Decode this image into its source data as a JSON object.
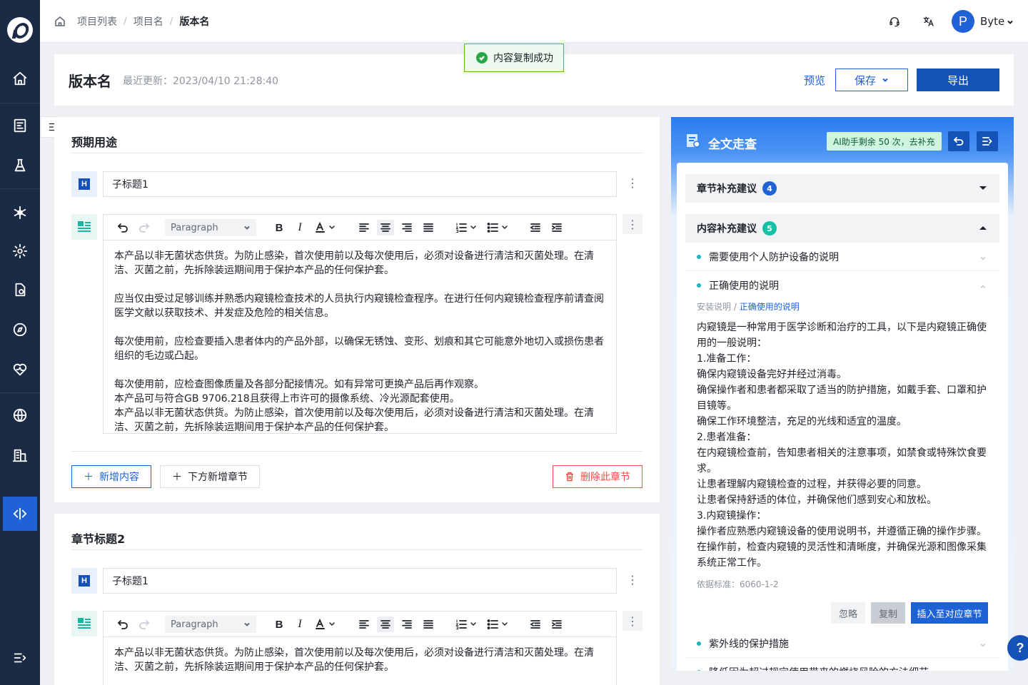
{
  "breadcrumb": [
    "项目列表",
    "项目名",
    "版本名"
  ],
  "user": {
    "avatar_letter": "P",
    "name": "Byte"
  },
  "header": {
    "title": "版本名",
    "updated": "最近更新：2023/04/10 21:28:40",
    "preview_label": "预览",
    "save_label": "保存",
    "export_label": "导出"
  },
  "toast": {
    "text": "内容复制成功"
  },
  "sidebar": {
    "icons": [
      "home-icon",
      "report-icon",
      "flask-icon",
      "snowflake-icon",
      "gear-icon",
      "file-icon",
      "compass-icon",
      "heart-icon",
      "globe-icon",
      "building-icon",
      "code-icon",
      "expand-icon"
    ]
  },
  "chapters": [
    {
      "title": "预期用途",
      "subtitle": "子标题1",
      "editor": {
        "paragraph_select": "Paragraph",
        "blocks": [
          [
            "本产品以非无菌状态供货。为防止感染，首次使用前以及每次使用后，必须对设备进行清洁和灭菌处理。在清",
            "洁、灭菌之前，先拆除装运期间用于保护本产品的任何保护套。"
          ],
          [
            "应当仅由受过足够训练并熟悉内窥镜检查技术的人员执行内窥镜检查程序。在进行任何内窥镜检查程序前请查阅",
            "医学文献以获取技术、并发症及危险的相关信息。"
          ],
          [
            "每次使用前，应检查要插入患者体内的产品外部，以确保无锈蚀、变形、划痕和其它可能意外地切入或损伤患者",
            "组织的毛边或凸起。"
          ],
          [
            "每次使用前，应检查图像质量及各部分配接情况。如有异常可更换产品后再作观察。",
            "本产品可与符合GB 9706.218且获得上市许可的摄像系统、冷光源配套使用。",
            "本产品以非无菌状态供货。为防止感染，首次使用前以及每次使用后，必须对设备进行清洁和灭菌处理。在清",
            "洁、灭菌之前，先拆除装运期间用于保护本产品的任何保护套。"
          ]
        ]
      },
      "add_content_label": "新增内容",
      "add_chapter_label": "下方新增章节",
      "delete_chapter_label": "删除此章节"
    },
    {
      "title": "章节标题2",
      "subtitle": "子标题1",
      "editor": {
        "paragraph_select": "Paragraph",
        "blocks": [
          [
            "本产品以非无菌状态供货。为防止感染，首次使用前以及每次使用后，必须对设备进行清洁和灭菌处理。在清",
            "洁、灭菌之前，先拆除装运期间用于保护本产品的任何保护套。"
          ]
        ]
      }
    }
  ],
  "ai_panel": {
    "title": "全文走查",
    "quota": "AI助手剩余 50 次，去补充",
    "sections": [
      {
        "label": "章节补充建议",
        "count": "4",
        "count_color": "#1f62d5",
        "expanded": false
      },
      {
        "label": "内容补充建议",
        "count": "5",
        "count_color": "#14c0a6",
        "expanded": true
      }
    ],
    "items": [
      {
        "label": "需要使用个人防护设备的说明",
        "expanded": false
      },
      {
        "label": "正确使用的说明",
        "expanded": true
      },
      {
        "label": "紫外线的保护措施",
        "expanded": false
      },
      {
        "label": "降低因为超过规定使用带来的燃烧风险的方法细节",
        "expanded": false
      }
    ],
    "detail": {
      "path_prefix": "安装说明",
      "path_link": "正确使用的说明",
      "lines": [
        "内窥镜是一种常用于医学诊断和治疗的工具，以下是内窥镜正确使",
        "用的一般说明：",
        "1.准备工作：",
        "确保内窥镜设备完好并经过消毒。",
        "确保操作者和患者都采取了适当的防护措施，如戴手套、口罩和护",
        "目镜等。",
        "确保工作环境整洁，充足的光线和适宜的温度。",
        "2.患者准备：",
        "在内窥镜检查前，告知患者相关的注意事项，如禁食或特殊饮食要",
        "求。",
        "让患者理解内窥镜检查的过程，并获得必要的同意。",
        "让患者保持舒适的体位，并确保他们感到安心和放松。",
        "3.内窥镜操作：",
        "操作者应熟悉内窥镜设备的使用说明书，并遵循正确的操作步骤。",
        "在操作前，检查内窥镜的灵活性和清晰度，并确保光源和图像采集",
        "系统正常工作。"
      ],
      "standard": "依据标准：6060-1-2",
      "ignore_label": "忽略",
      "copy_label": "复制",
      "insert_label": "插入至对应章节"
    }
  },
  "help": {
    "label": "?"
  }
}
